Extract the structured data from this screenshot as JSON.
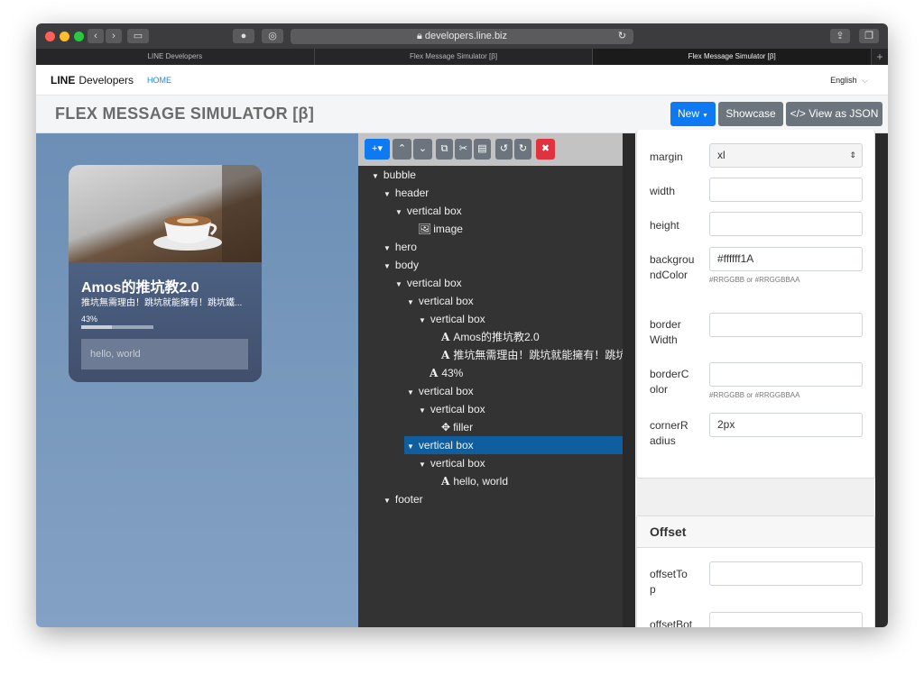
{
  "browser": {
    "url": "developers.line.biz",
    "tabs": [
      "LINE Developers",
      "Flex Message Simulator [β]",
      "Flex Message Simulator [β]"
    ]
  },
  "nav": {
    "brand_bold": "LINE",
    "brand_rest": "Developers",
    "home": "HOME",
    "language": "English"
  },
  "sim": {
    "title": "FLEX MESSAGE SIMULATOR [β]",
    "new_button": "New",
    "showcase_button": "Showcase",
    "json_button": "</> View as JSON"
  },
  "preview": {
    "title": "Amos的推坑教2.0",
    "subtitle": "推坑無需理由！跳坑就能擁有！跳坑鐵...",
    "progress_label": "43%",
    "progress": 0.43,
    "input_placeholder": "hello, world"
  },
  "tree": [
    {
      "label": "bubble",
      "kind": "caret",
      "depth": 0
    },
    {
      "label": "header",
      "kind": "caret",
      "depth": 1
    },
    {
      "label": "vertical box",
      "kind": "caret",
      "depth": 2
    },
    {
      "label": "image",
      "kind": "image",
      "depth": 3
    },
    {
      "label": "hero",
      "kind": "caret",
      "depth": 1
    },
    {
      "label": "body",
      "kind": "caret",
      "depth": 1
    },
    {
      "label": "vertical box",
      "kind": "caret",
      "depth": 2
    },
    {
      "label": "vertical box",
      "kind": "caret",
      "depth": 3
    },
    {
      "label": "vertical box",
      "kind": "caret",
      "depth": 4
    },
    {
      "label": "Amos的推坑教2.0",
      "kind": "text",
      "depth": 5
    },
    {
      "label": "推坑無需理由！跳坑就能擁有！跳坑...",
      "kind": "text",
      "depth": 5
    },
    {
      "label": "43%",
      "kind": "text",
      "depth": 4
    },
    {
      "label": "vertical box",
      "kind": "caret",
      "depth": 3
    },
    {
      "label": "vertical box",
      "kind": "caret",
      "depth": 4
    },
    {
      "label": "filler",
      "kind": "filler",
      "depth": 5
    },
    {
      "label": "vertical box",
      "kind": "caret",
      "depth": 3,
      "selected": true
    },
    {
      "label": "vertical box",
      "kind": "caret",
      "depth": 4
    },
    {
      "label": "hello, world",
      "kind": "text",
      "depth": 5
    },
    {
      "label": "footer",
      "kind": "caret",
      "depth": 1
    }
  ],
  "props": {
    "margin_label": "margin",
    "margin_value": "xl",
    "width_label": "width",
    "height_label": "height",
    "bg_label": "backgroundColor",
    "bg_value": "#ffffff1A",
    "bg_hint": "#RRGGBB or #RRGGBBAA",
    "border_width_label": "borderWidth",
    "border_color_label": "borderColor",
    "border_color_hint": "#RRGGBB or #RRGGBBAA",
    "corner_label": "cornerRadius",
    "corner_value": "2px",
    "offset_title": "Offset",
    "offset_top_label": "offsetTop",
    "offset_bottom_label": "offsetBottom"
  }
}
